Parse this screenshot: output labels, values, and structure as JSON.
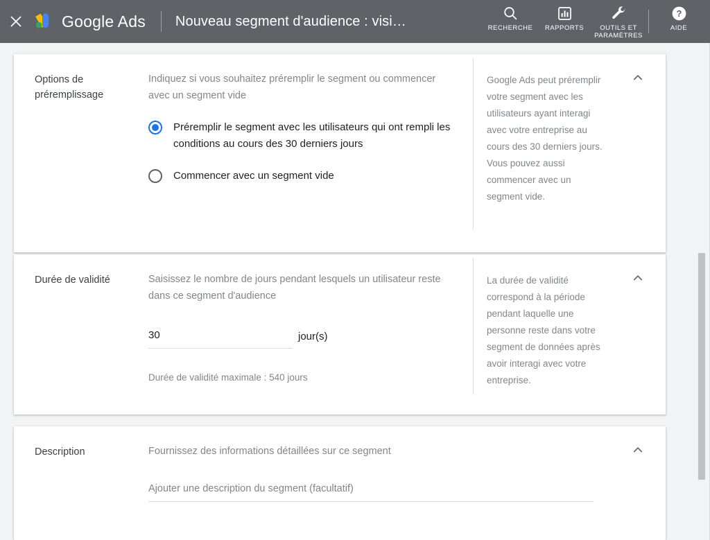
{
  "topbar": {
    "close_icon": "close-icon",
    "brand_name": "Google Ads",
    "brand_logo_icon": "google-ads-logo-icon",
    "page_title": "Nouveau segment d'audience : visi…",
    "actions": [
      {
        "icon": "search-icon",
        "label": "RECHERCHE"
      },
      {
        "icon": "bar-chart-icon",
        "label": "RAPPORTS"
      },
      {
        "icon": "wrench-icon",
        "label": "OUTILS ET\nPARAMÈTRES"
      },
      {
        "icon": "help-circle-icon",
        "label": "AIDE"
      }
    ],
    "background_color": "#5f6368"
  },
  "accent_color": "#1a73e8",
  "cards": [
    {
      "id": "prefill",
      "label": "Options de préremplissage",
      "description": "Indiquez si vous souhaitez préremplir le segment ou commencer avec un segment vide",
      "collapse_icon": "chevron-up-icon",
      "help": "Google Ads peut préremplir votre segment avec les utilisateurs ayant interagi avec votre entreprise au cours des 30 derniers jours. Vous pouvez aussi commencer avec un segment vide.",
      "radios": [
        {
          "label": "Préremplir le segment avec les utilisateurs qui ont rempli les conditions au cours des 30 derniers jours",
          "selected": true
        },
        {
          "label": "Commencer avec un segment vide",
          "selected": false
        }
      ]
    },
    {
      "id": "duration",
      "label": "Durée de validité",
      "description": "Saisissez le nombre de jours pendant lesquels un utilisateur reste dans ce segment d'audience",
      "collapse_icon": "chevron-up-icon",
      "help": "La durée de validité correspond à la période pendant laquelle une personne reste dans votre segment de données après avoir interagi avec votre entreprise.",
      "input_value": "30",
      "input_unit": "jour(s)",
      "max_note": "Durée de validité maximale : 540 jours"
    },
    {
      "id": "description",
      "label": "Description",
      "description": "Fournissez des informations détaillées sur ce segment",
      "collapse_icon": "chevron-up-icon",
      "input_value": "",
      "input_placeholder": "Ajouter une description du segment (facultatif)"
    }
  ]
}
